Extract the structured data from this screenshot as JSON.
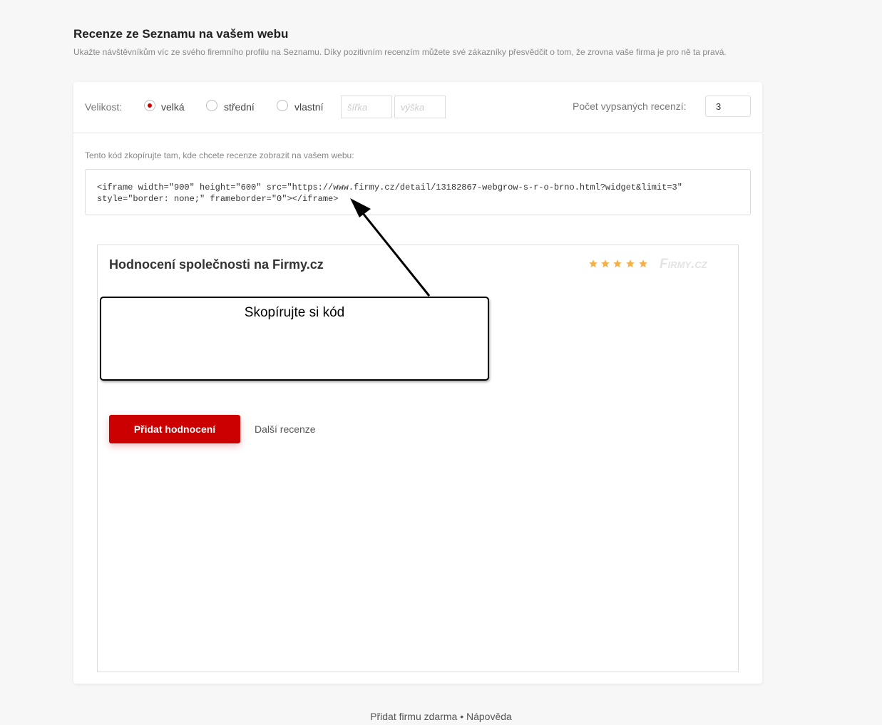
{
  "header": {
    "title": "Recenze ze Seznamu na vašem webu",
    "subtitle": "Ukažte návštěvníkům víc ze svého firemního profilu na Seznamu. Díky pozitivním recenzím můžete své zákazníky přesvědčit o tom, že zrovna vaše firma je pro ně ta pravá."
  },
  "settings": {
    "size_label": "Velikost:",
    "size_options": [
      {
        "label": "velká",
        "checked": true
      },
      {
        "label": "střední",
        "checked": false
      },
      {
        "label": "vlastní",
        "checked": false
      }
    ],
    "width_placeholder": "šířka",
    "height_placeholder": "výška",
    "count_label": "Počet vypsaných recenzí:",
    "count_value": "3"
  },
  "code": {
    "hint": "Tento kód zkopírujte tam, kde chcete recenze zobrazit na vašem webu:",
    "snippet": "<iframe width=\"900\" height=\"600\" src=\"https://www.firmy.cz/detail/13182867-webgrow-s-r-o-brno.html?widget&limit=3\"\nstyle=\"border: none;\" frameborder=\"0\"></iframe>"
  },
  "preview": {
    "title": "Hodnocení společnosti na Firmy.cz",
    "stars": 5,
    "star_color": "#f5b04a",
    "logo_text": "Firmy.cz",
    "add_button": "Přidat hodnocení",
    "more_link": "Další recenze",
    "accent_color": "#cc0000"
  },
  "annotation": {
    "callout_text": "Skopírujte si kód"
  },
  "footer": {
    "add_company": "Přidat firmu zdarma",
    "separator": "•",
    "help": "Nápověda"
  }
}
